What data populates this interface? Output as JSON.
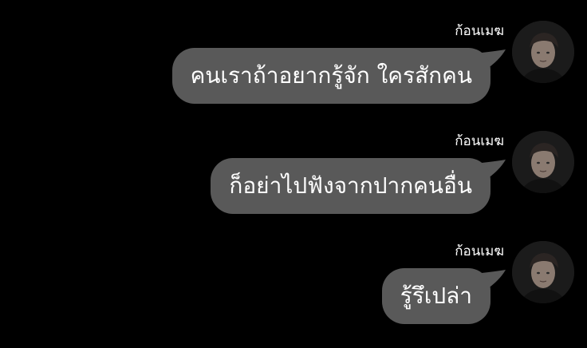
{
  "chat": {
    "accent_bubble": "#595959",
    "background": "#000000",
    "messages": [
      {
        "sender": "ก้อนเมฆ",
        "text": "คนเราถ้าอยากรู้จัก ใครสักคน",
        "avatar_icon": "profile-photo"
      },
      {
        "sender": "ก้อนเมฆ",
        "text": "ก็อย่าไปฟังจากปากคนอื่น",
        "avatar_icon": "profile-photo"
      },
      {
        "sender": "ก้อนเมฆ",
        "text": "รู้รึเปล่า",
        "avatar_icon": "profile-photo"
      }
    ]
  }
}
